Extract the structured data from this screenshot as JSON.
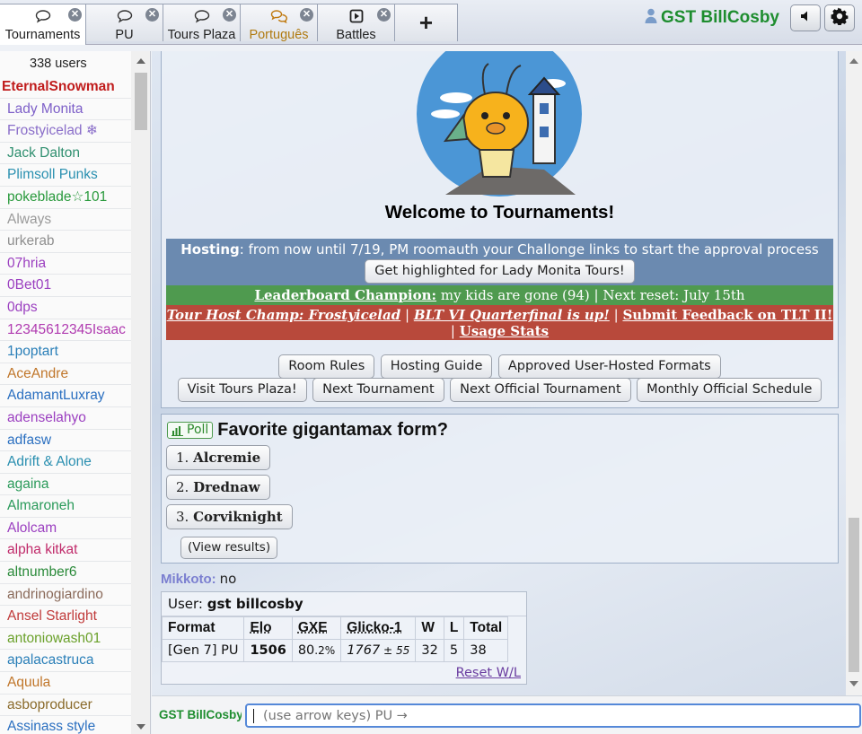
{
  "tabs": [
    {
      "label": "Tournaments",
      "icon": "chat-bubble-icon",
      "active": true
    },
    {
      "label": "PU",
      "icon": "chat-bubble-icon"
    },
    {
      "label": "Tours Plaza",
      "icon": "chat-bubble-icon"
    },
    {
      "label": "Português",
      "icon": "chat-bubbles-icon"
    },
    {
      "label": "Battles",
      "icon": "battle-icon"
    }
  ],
  "add_tab_label": "+",
  "header": {
    "username": "GST BillCosby"
  },
  "userlist": {
    "count": "338 users",
    "users": [
      {
        "name": "EternalSnowman",
        "color": "#c01b1b",
        "staff": true
      },
      {
        "name": "Lady Monita",
        "color": "#7d5fc8"
      },
      {
        "name": "Frostyicelad ❄",
        "color": "#8a6ec9"
      },
      {
        "name": "Jack Dalton",
        "color": "#2f8f6f"
      },
      {
        "name": "Plimsoll Punks",
        "color": "#2a90b0"
      },
      {
        "name": "pokeblade☆101",
        "color": "#2a9a3d"
      },
      {
        "name": "Always",
        "color": "#9a9a9a"
      },
      {
        "name": "urkerab",
        "color": "#8f8f8f"
      },
      {
        "name": "07hria",
        "color": "#9b3fc0"
      },
      {
        "name": "0Bet01",
        "color": "#9b3fc0"
      },
      {
        "name": "0dps",
        "color": "#9b3fc0"
      },
      {
        "name": "12345612345Isaac",
        "color": "#b03ab0"
      },
      {
        "name": "1poptart",
        "color": "#2a7fb8"
      },
      {
        "name": "AceAndre",
        "color": "#c0762a"
      },
      {
        "name": "AdamantLuxray",
        "color": "#2a6fc0"
      },
      {
        "name": "adenselahyo",
        "color": "#9b3fc0"
      },
      {
        "name": "adfasw",
        "color": "#2a6fc0"
      },
      {
        "name": "Adrift & Alone",
        "color": "#2a8fb0"
      },
      {
        "name": "againa",
        "color": "#2a9a5a"
      },
      {
        "name": "Almaroneh",
        "color": "#2a9a5a"
      },
      {
        "name": "Alolcam",
        "color": "#9b3fc0"
      },
      {
        "name": "alpha kitkat",
        "color": "#c02a6a"
      },
      {
        "name": "altnumber6",
        "color": "#2a8a3a"
      },
      {
        "name": "andrinogiardino",
        "color": "#8a6a5a"
      },
      {
        "name": "Ansel Starlight",
        "color": "#c03a3a"
      },
      {
        "name": "antoniowash01",
        "color": "#6aa02a"
      },
      {
        "name": "apalacastruca",
        "color": "#2a7fb8"
      },
      {
        "name": "Aquula",
        "color": "#c0762a"
      },
      {
        "name": "asboproducer",
        "color": "#8a6a2a"
      },
      {
        "name": "Assinass style",
        "color": "#2a6fc0"
      }
    ]
  },
  "intro": {
    "welcome": "Welcome to Tournaments!",
    "hosting_label": "Hosting",
    "hosting_text": ": from now until 7/19, PM roomauth your Challonge links to start the approval process",
    "highlight_button": "Get highlighted for Lady Monita Tours!",
    "leaderboard_link": "Leaderboard Champion:",
    "leaderboard_text": " my kids are gone (94) | Next reset: July 15th",
    "champ_link": "Tour Host Champ: Frostyicelad",
    "sep1": " | ",
    "blt_link": "BLT VI Quarterfinal is up!",
    "sep2": " | ",
    "feedback_link": "Submit Feedback on TLT II!",
    "sep3": " | ",
    "usage_link": "Usage Stats",
    "buttons_row1": [
      "Room Rules",
      "Hosting Guide",
      "Approved User-Hosted Formats"
    ],
    "buttons_row2": [
      "Visit Tours Plaza!",
      "Next Tournament",
      "Next Official Tournament",
      "Monthly Official Schedule"
    ]
  },
  "poll": {
    "badge": "Poll",
    "question": "Favorite gigantamax form?",
    "options": [
      {
        "num": "1.",
        "name": "Alcremie"
      },
      {
        "num": "2.",
        "name": "Drednaw"
      },
      {
        "num": "3.",
        "name": "Corviknight"
      }
    ],
    "view_results": "(View results)"
  },
  "message": {
    "author": "Mikkoto:",
    "text": "no"
  },
  "ladder": {
    "user_label": "User:",
    "user_name": "gst billcosby",
    "headers": [
      "Format",
      "Elo",
      "GXE",
      "Glicko-1",
      "W",
      "L",
      "Total"
    ],
    "row": {
      "format": "[Gen 7] PU",
      "elo": "1506",
      "gxe": "80",
      "gxe_dec": ".2%",
      "glicko": "1767",
      "glicko_dev": " ± 55",
      "w": "32",
      "l": "5",
      "total": "38"
    },
    "reset": "Reset W/L"
  },
  "composer": {
    "name": "GST BillCosby",
    "placeholder": "(use arrow keys) PU →"
  }
}
